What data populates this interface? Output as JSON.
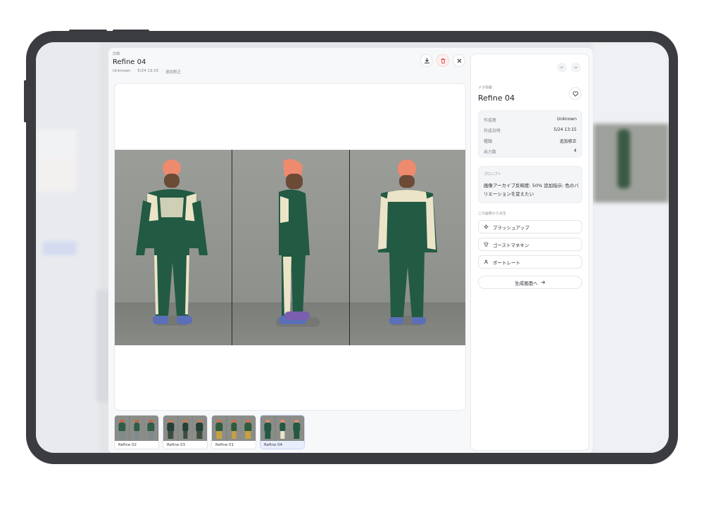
{
  "header": {
    "category": "詳細",
    "title": "Refine 04",
    "meta": [
      "Unknown",
      "5/24 13:15",
      "追加修正"
    ]
  },
  "sidebar": {
    "category": "メタ情報",
    "title": "Refine 04",
    "meta": [
      {
        "key": "作成者",
        "value": "Unknown"
      },
      {
        "key": "作成日時",
        "value": "5/24 13:15"
      },
      {
        "key": "種類",
        "value": "追加修正"
      },
      {
        "key": "出力数",
        "value": "4"
      }
    ],
    "prompt_label": "プロンプト",
    "prompt_text": "画像アーカイブ反映度: 50% 追加指示: 色のバリエーションを変えたい",
    "from_label": "この画像から派生",
    "actions": [
      {
        "label": "ブラッシュアップ",
        "icon": "sparkle-icon"
      },
      {
        "label": "ゴーストマネキン",
        "icon": "shirt-icon"
      },
      {
        "label": "ポートレート",
        "icon": "person-icon"
      }
    ],
    "generate_label": "生成画面へ"
  },
  "thumbnails": [
    {
      "label": "Refine 02",
      "active": false,
      "colors": [
        "#2f5d47",
        "#7f8a8f",
        "#c8663e"
      ]
    },
    {
      "label": "Refine 03",
      "active": false,
      "colors": [
        "#243f35",
        "#3b4d3f",
        "#d07a4e"
      ]
    },
    {
      "label": "Refine 01",
      "active": false,
      "colors": [
        "#2f5b3e",
        "#c9a040",
        "#d6704a"
      ]
    },
    {
      "label": "Refine 04",
      "active": true,
      "colors": [
        "#235842",
        "#ece4c8",
        "#e88a6b"
      ]
    }
  ],
  "colors": {
    "jacket": "#225a43",
    "panel": "#ece4c8",
    "beanie": "#ee8a6e",
    "skin": "#6b4a36",
    "shoe": "#5a6fb8",
    "accent_delete": "#e34a4a"
  }
}
